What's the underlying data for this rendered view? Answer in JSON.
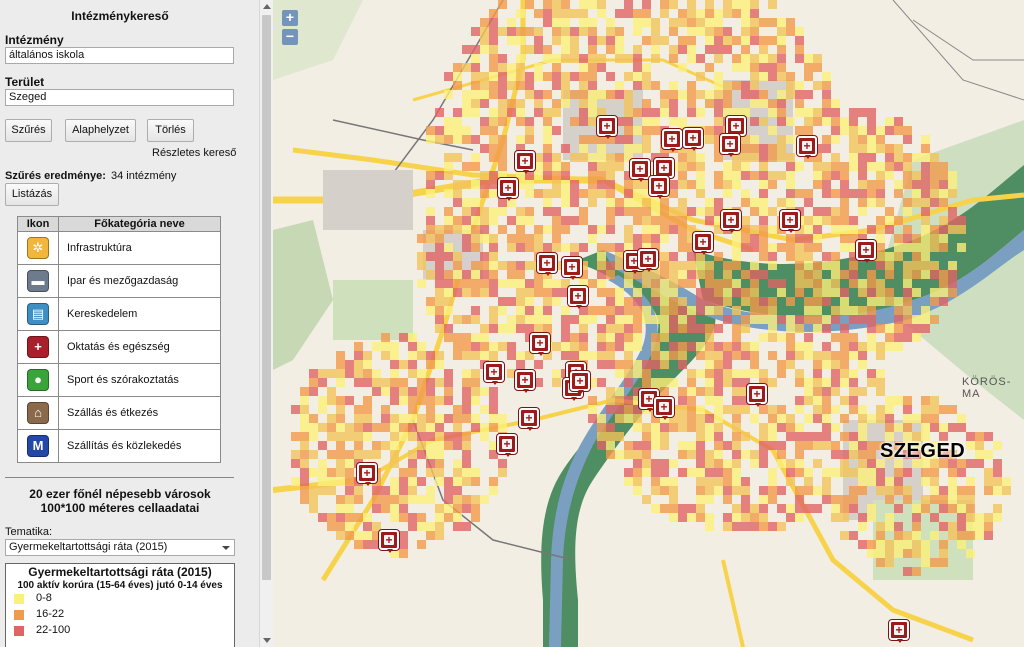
{
  "panel": {
    "title": "Intézménykereső",
    "institution_label": "Intézmény",
    "institution_value": "általános iskola",
    "area_label": "Terület",
    "area_value": "Szeged",
    "filter_button": "Szűrés",
    "default_button": "Alaphelyzet",
    "clear_button": "Törlés",
    "advanced_link": "Részletes kereső",
    "result_label": "Szűrés eredménye:",
    "result_value": "34 intézmény",
    "list_button": "Listázás"
  },
  "categories": {
    "header_icon": "Ikon",
    "header_name": "Főkategória neve",
    "items": [
      {
        "label": "Infrastruktúra",
        "icon": "gear-icon",
        "color": "#f2b63a",
        "glyph": "✲"
      },
      {
        "label": "Ipar és mezőgazdaság",
        "icon": "truck-icon",
        "color": "#6d7b8c",
        "glyph": "▬"
      },
      {
        "label": "Kereskedelem",
        "icon": "shop-icon",
        "color": "#3d8fc4",
        "glyph": "▤"
      },
      {
        "label": "Oktatás és egészség",
        "icon": "cross-icon",
        "color": "#a8202b",
        "glyph": "+"
      },
      {
        "label": "Sport és szórakoztatás",
        "icon": "ball-icon",
        "color": "#3aa33a",
        "glyph": "●"
      },
      {
        "label": "Szállás és étkezés",
        "icon": "house-icon",
        "color": "#8a6a4a",
        "glyph": "⌂"
      },
      {
        "label": "Szállítás és közlekedés",
        "icon": "metro-icon",
        "color": "#2448a8",
        "glyph": "M"
      }
    ]
  },
  "cells": {
    "header_line1": "20 ezer főnél népesebb városok",
    "header_line2": "100*100 méteres cellaadatai",
    "theme_label": "Tematika:",
    "theme_value": "Gyermekeltartottsági ráta (2015)"
  },
  "legend": {
    "title": "Gyermekeltartottsági ráta (2015)",
    "subtitle": "100 aktív korúra (15-64 éves) jutó 0-14 éves",
    "items": [
      {
        "label": "0-8",
        "color": "#fbf07a"
      },
      {
        "label": "16-22",
        "color": "#f19a4a"
      },
      {
        "label": "22-100",
        "color": "#e06464"
      }
    ]
  },
  "map": {
    "zoom_in": "+",
    "zoom_out": "−",
    "city_label": "SZEGED",
    "region_label": "KÖRÖS-MA",
    "pins_count": 34
  }
}
